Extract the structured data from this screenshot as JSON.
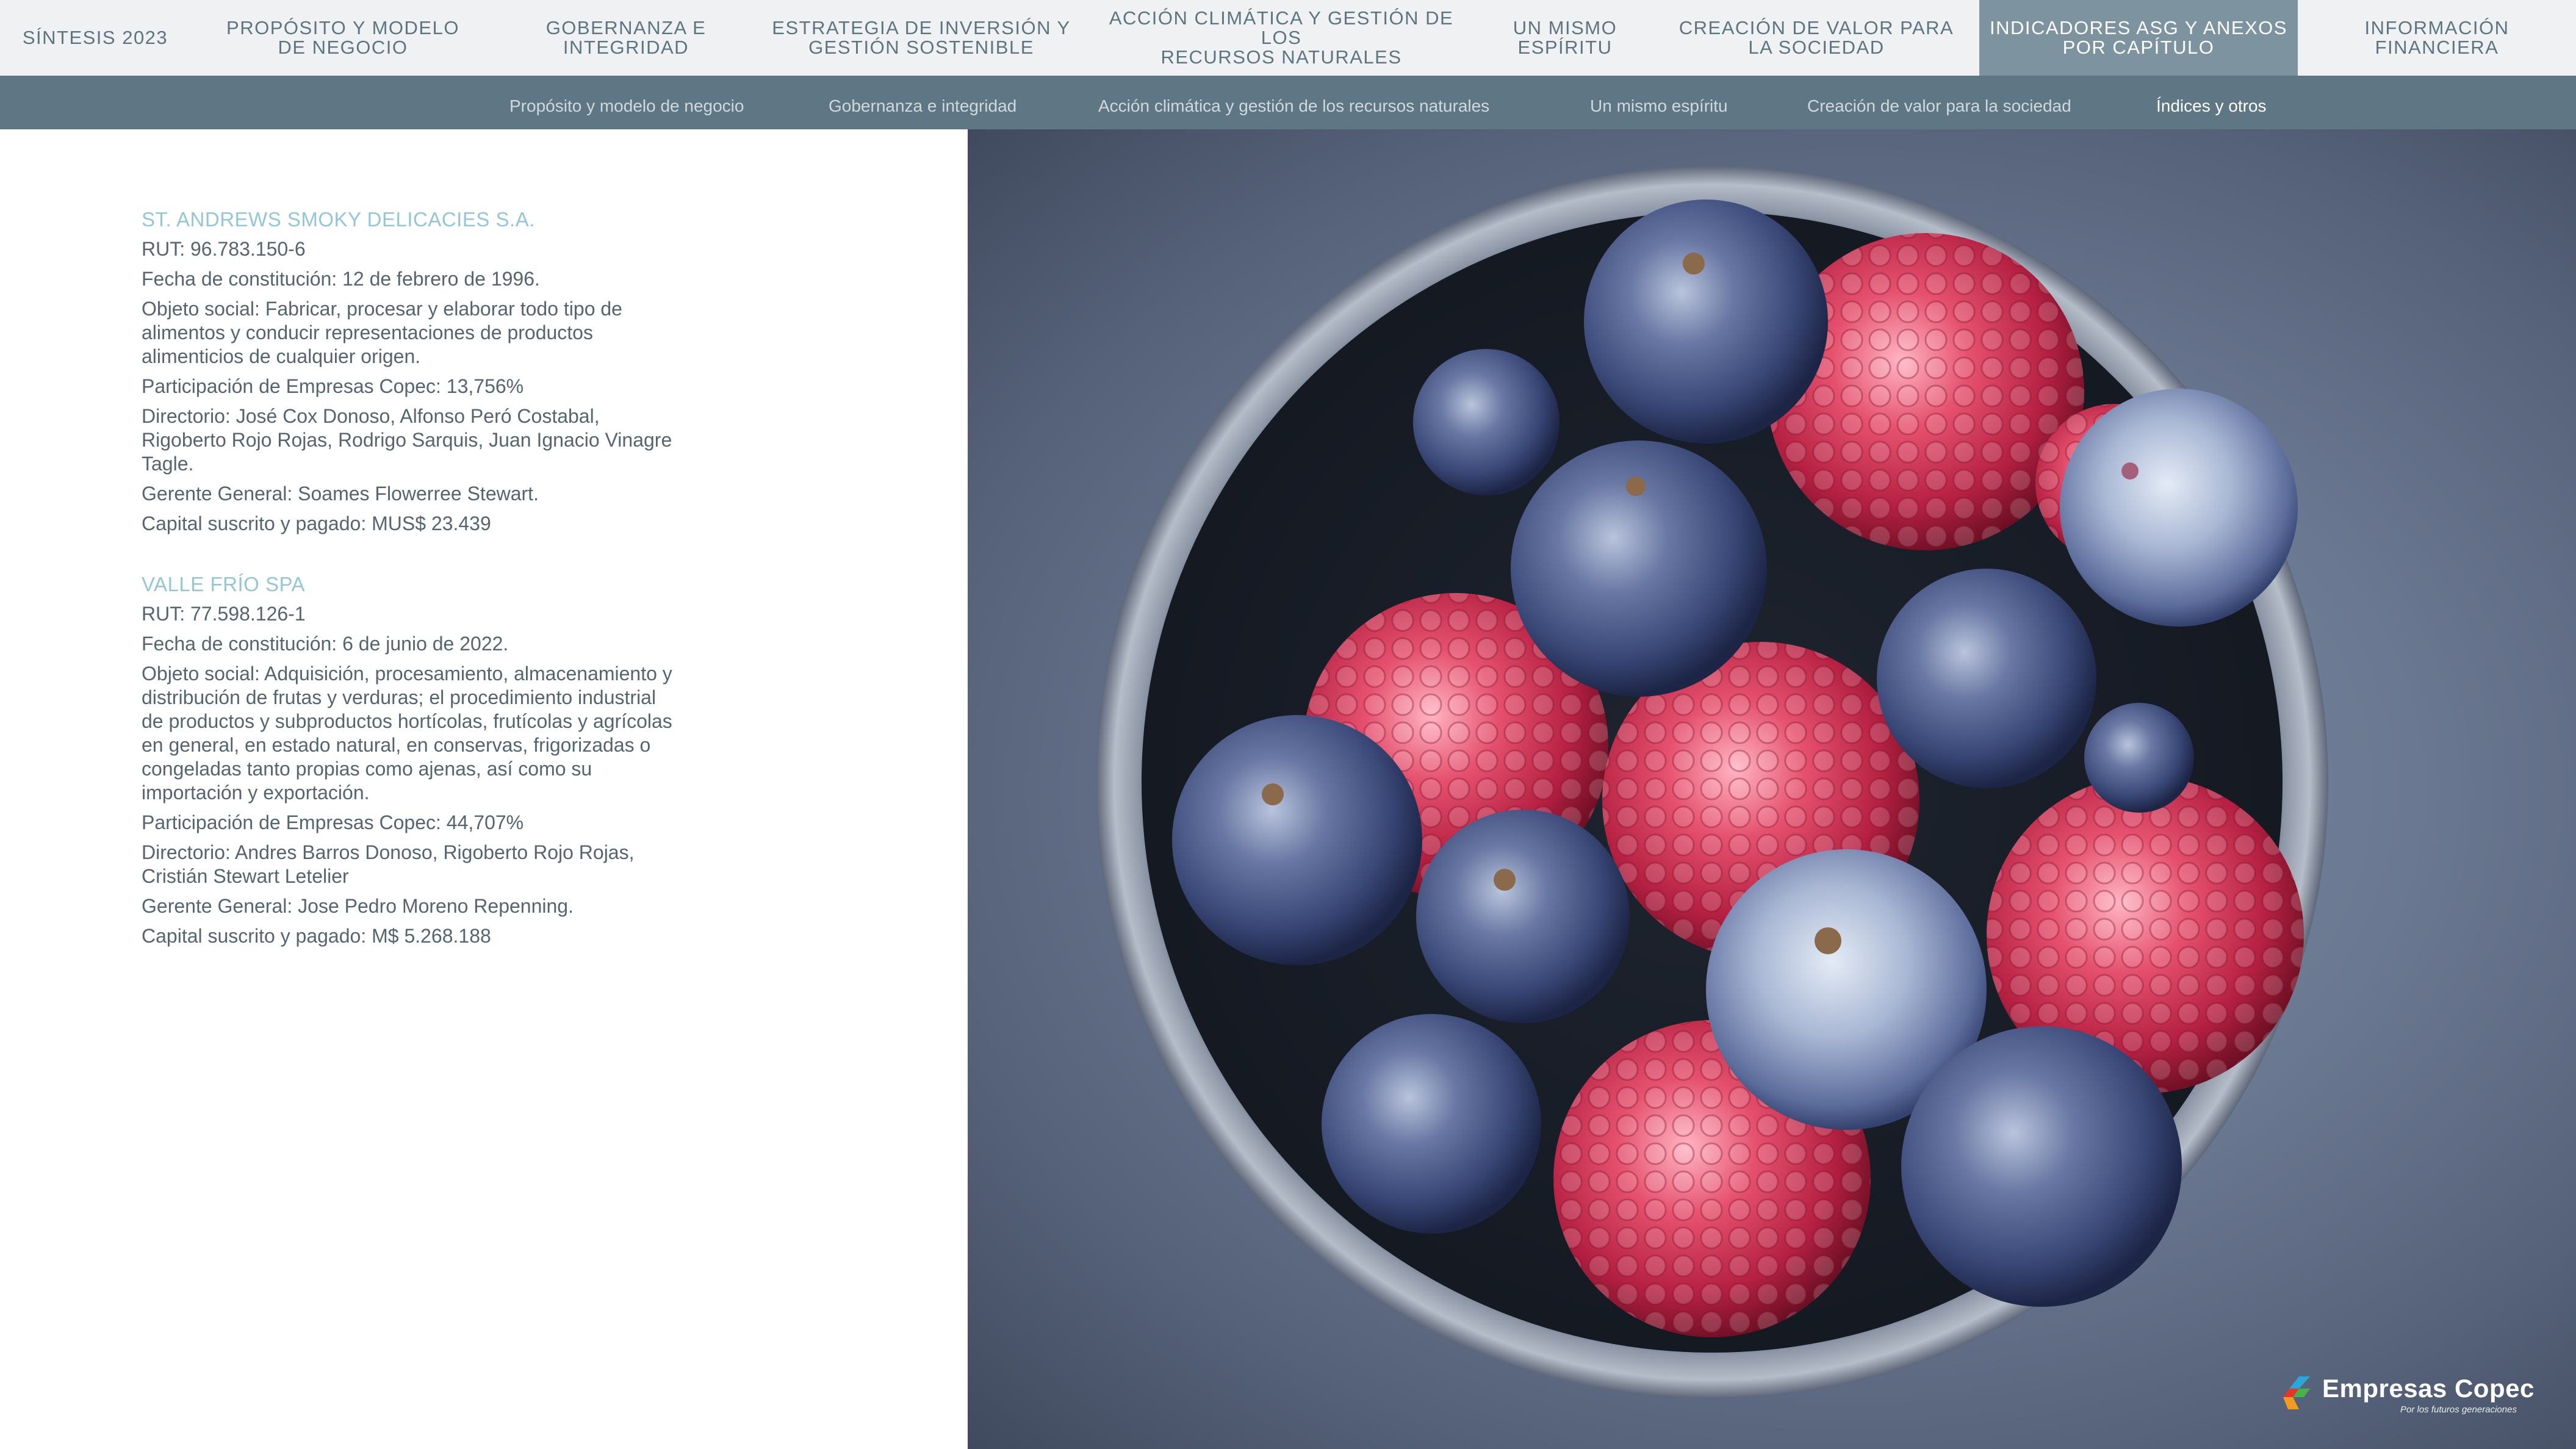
{
  "top_nav": [
    {
      "label": "SÍNTESIS  2023"
    },
    {
      "label": "PROPÓSITO Y MODELO\nDE NEGOCIO"
    },
    {
      "label": "GOBERNANZA  E\nINTEGRIDAD"
    },
    {
      "label": "ESTRATEGIA DE INVERSIÓN Y\nGESTIÓN SOSTENIBLE"
    },
    {
      "label": "ACCIÓN CLIMÁTICA Y GESTIÓN DE LOS\nRECURSOS NATURALES"
    },
    {
      "label": "UN MISMO ESPÍRITU"
    },
    {
      "label": "CREACIÓN DE VALOR  PARA\nLA SOCIEDAD"
    },
    {
      "label": "INDICADORES  ASG Y ANEXOS\nPOR CAPÍTULO"
    },
    {
      "label": "INFORMACIÓN\nFINANCIERA"
    }
  ],
  "sub_nav": [
    {
      "label": "Propósito y modelo de negocio"
    },
    {
      "label": "Gobernanza e integridad"
    },
    {
      "label": "Acción climática y gestión de los recursos naturales"
    },
    {
      "label": "Un mismo espíritu"
    },
    {
      "label": "Creación de valor para la sociedad"
    },
    {
      "label": "Índices y otros"
    }
  ],
  "companies": [
    {
      "name": "ST. ANDREWS SMOKY DELICACIES S.A.",
      "lines": [
        "RUT: 96.783.150-6",
        "Fecha de constitución: 12 de febrero de 1996.",
        "Objeto social: Fabricar, procesar y elaborar todo tipo de alimentos y conducir representaciones de productos alimenticios de cualquier origen.",
        "Participación de Empresas Copec: 13,756%",
        "Directorio: José Cox Donoso, Alfonso Peró Costabal, Rigoberto Rojo Rojas, Rodrigo Sarquis, Juan Ignacio Vinagre Tagle.",
        "Gerente General: Soames Flowerree Stewart.",
        "Capital suscrito y pagado: MUS$ 23.439"
      ]
    },
    {
      "name": "VALLE FRÍO SPA",
      "lines": [
        "RUT: 77.598.126-1",
        "Fecha de constitución: 6 de junio de 2022.",
        "Objeto social: Adquisición, procesamiento, almacenamiento y distribución de frutas y verduras; el procedimiento industrial de productos y subproductos hortícolas, frutícolas y agrícolas en general, en estado natural, en conservas, frigorizadas o congeladas tanto propias como ajenas, así como su importación y exportación.",
        "Participación de Empresas Copec: 44,707%",
        "Directorio: Andres Barros Donoso, Rigoberto Rojo Rojas, Cristián Stewart Letelier",
        "Gerente General: Jose Pedro Moreno Repenning.",
        "Capital suscrito y pagado: M$ 5.268.188"
      ]
    }
  ],
  "logo": {
    "brand": "Empresas Copec",
    "tagline": "Por los futuros generaciones"
  },
  "colors": {
    "nav_bg": "#eff1f3",
    "nav_text": "#5d7581",
    "nav_active_bg": "#7e93a0",
    "subnav_bg": "#5f7785",
    "company_title": "#93c7d6",
    "body_text": "#55656f"
  }
}
